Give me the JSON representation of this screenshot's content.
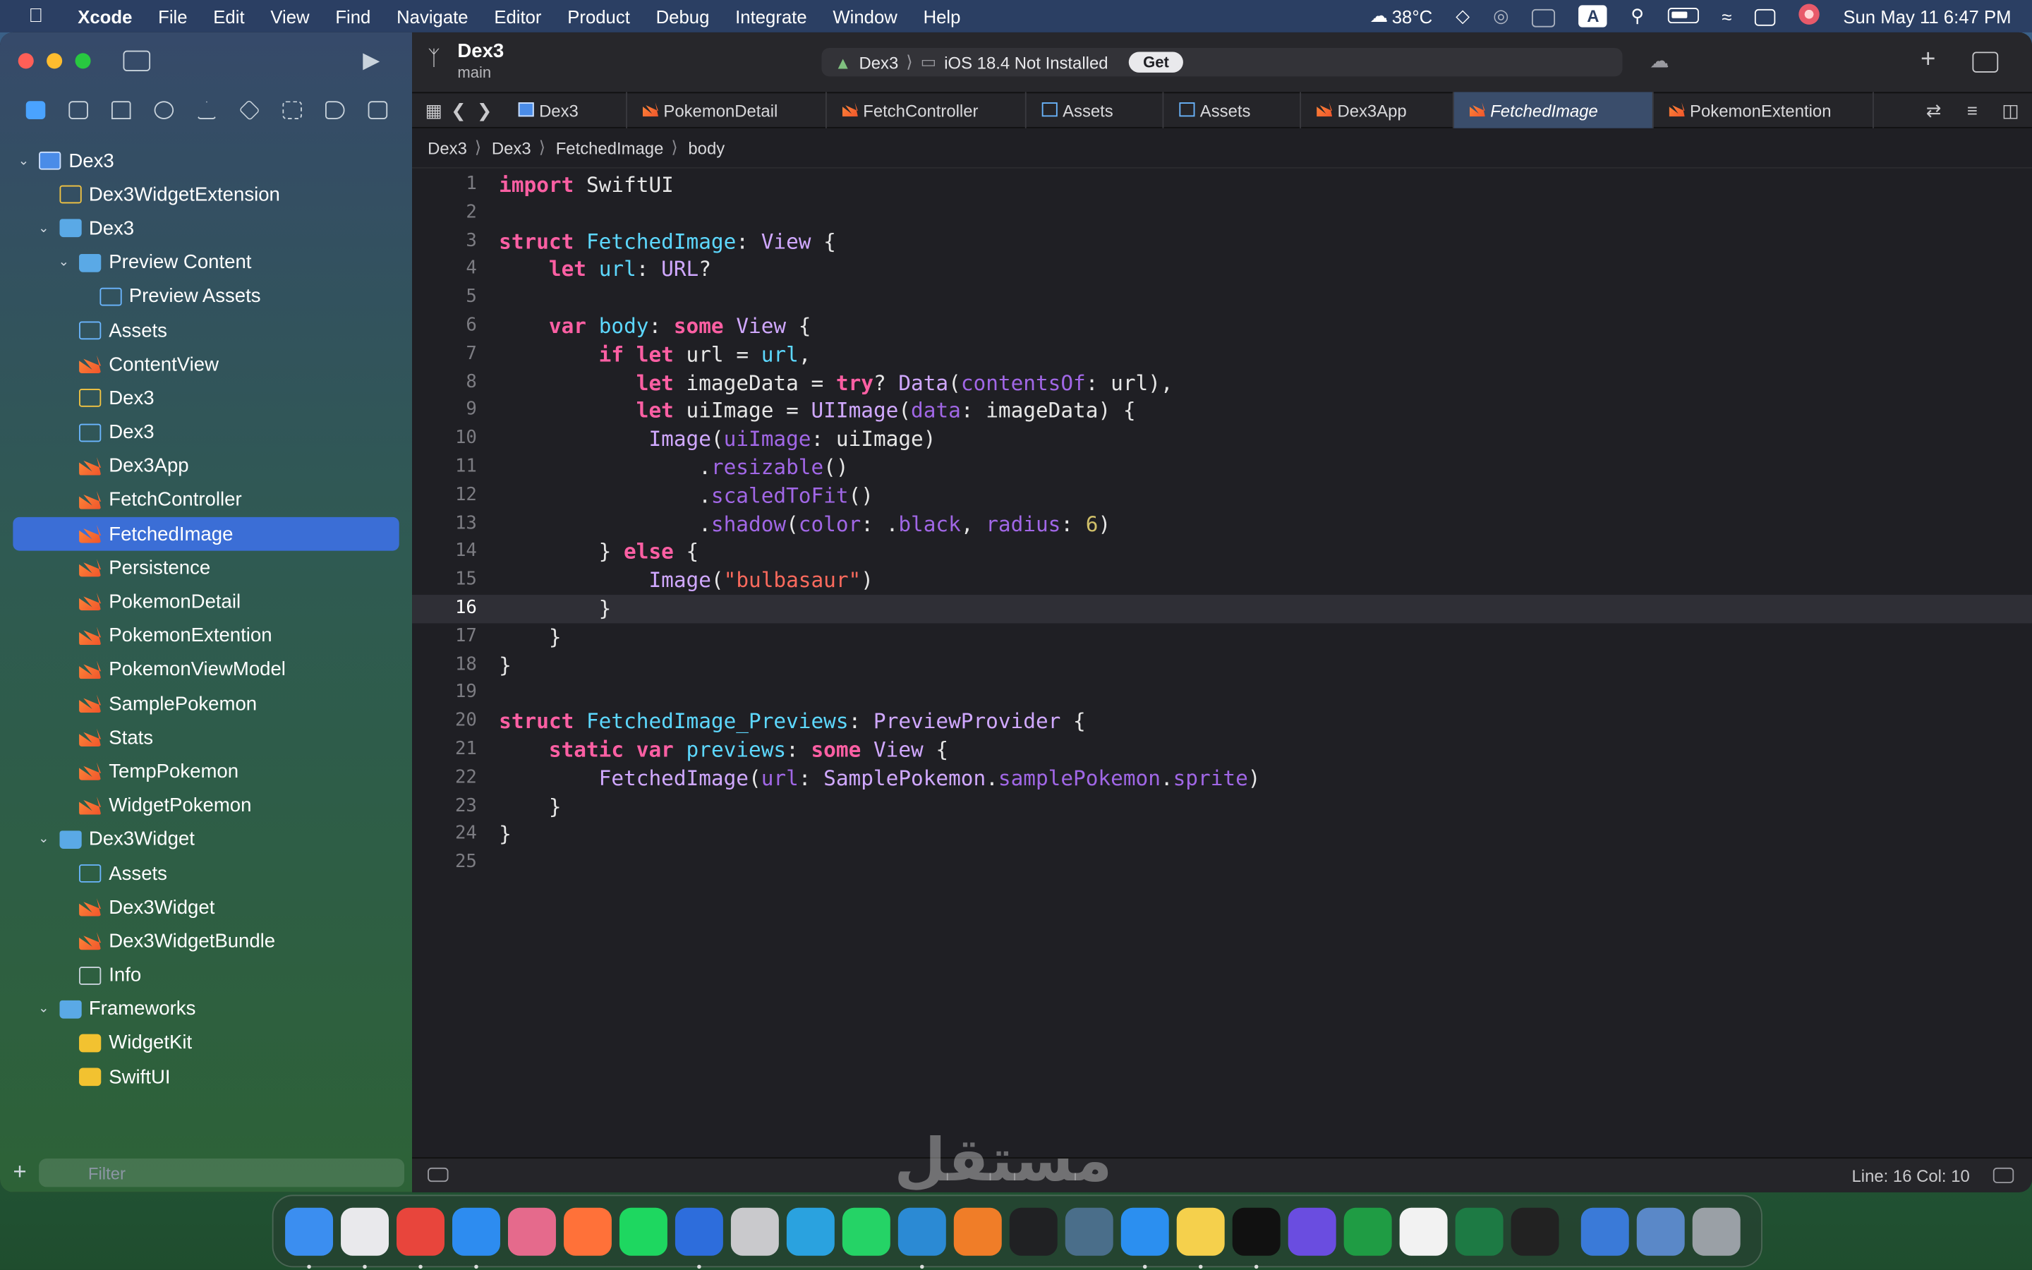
{
  "menubar": {
    "app": "Xcode",
    "items": [
      "File",
      "Edit",
      "View",
      "Find",
      "Navigate",
      "Editor",
      "Product",
      "Debug",
      "Integrate",
      "Window",
      "Help"
    ],
    "weather": "38°C",
    "input_badge": "A",
    "datetime": "Sun May 11  6:47 PM"
  },
  "window": {
    "project": "Dex3",
    "branch": "main",
    "scheme": "Dex3",
    "destination": "iOS 18.4 Not Installed",
    "get_label": "Get"
  },
  "sidebar": {
    "filter_placeholder": "Filter",
    "rows": [
      {
        "label": "Dex3",
        "depth": 0,
        "icon": "project",
        "chev": "down"
      },
      {
        "label": "Dex3WidgetExtension",
        "depth": 1,
        "icon": "ext"
      },
      {
        "label": "Dex3",
        "depth": 1,
        "icon": "folder",
        "chev": "down"
      },
      {
        "label": "Preview Content",
        "depth": 2,
        "icon": "folder",
        "chev": "down"
      },
      {
        "label": "Preview Assets",
        "depth": 3,
        "icon": "asset"
      },
      {
        "label": "Assets",
        "depth": 2,
        "icon": "asset"
      },
      {
        "label": "ContentView",
        "depth": 2,
        "icon": "swift"
      },
      {
        "label": "Dex3",
        "depth": 2,
        "icon": "ext"
      },
      {
        "label": "Dex3",
        "depth": 2,
        "icon": "asset"
      },
      {
        "label": "Dex3App",
        "depth": 2,
        "icon": "swift"
      },
      {
        "label": "FetchController",
        "depth": 2,
        "icon": "swift"
      },
      {
        "label": "FetchedImage",
        "depth": 2,
        "icon": "swift",
        "selected": true
      },
      {
        "label": "Persistence",
        "depth": 2,
        "icon": "swift"
      },
      {
        "label": "PokemonDetail",
        "depth": 2,
        "icon": "swift"
      },
      {
        "label": "PokemonExtention",
        "depth": 2,
        "icon": "swift"
      },
      {
        "label": "PokemonViewModel",
        "depth": 2,
        "icon": "swift"
      },
      {
        "label": "SamplePokemon",
        "depth": 2,
        "icon": "swift"
      },
      {
        "label": "Stats",
        "depth": 2,
        "icon": "swift"
      },
      {
        "label": "TempPokemon",
        "depth": 2,
        "icon": "swift"
      },
      {
        "label": "WidgetPokemon",
        "depth": 2,
        "icon": "swift"
      },
      {
        "label": "Dex3Widget",
        "depth": 1,
        "icon": "folder",
        "chev": "down"
      },
      {
        "label": "Assets",
        "depth": 2,
        "icon": "asset"
      },
      {
        "label": "Dex3Widget",
        "depth": 2,
        "icon": "swift"
      },
      {
        "label": "Dex3WidgetBundle",
        "depth": 2,
        "icon": "swift"
      },
      {
        "label": "Info",
        "depth": 2,
        "icon": "plist"
      },
      {
        "label": "Frameworks",
        "depth": 1,
        "icon": "folder",
        "chev": "down"
      },
      {
        "label": "WidgetKit",
        "depth": 2,
        "icon": "fw"
      },
      {
        "label": "SwiftUI",
        "depth": 2,
        "icon": "fw"
      }
    ]
  },
  "tabs": [
    {
      "label": "Dex3",
      "icon": "project",
      "w": 96
    },
    {
      "label": "PokemonDetail",
      "icon": "swift",
      "w": 154
    },
    {
      "label": "FetchController",
      "icon": "swift",
      "w": 154
    },
    {
      "label": "Assets",
      "icon": "asset",
      "w": 106
    },
    {
      "label": "Assets",
      "icon": "asset",
      "w": 106
    },
    {
      "label": "Dex3App",
      "icon": "swift",
      "w": 118
    },
    {
      "label": "FetchedImage",
      "icon": "swift",
      "w": 154,
      "active": true
    },
    {
      "label": "PokemonExtention",
      "icon": "swift",
      "w": 170
    }
  ],
  "breadcrumb": [
    "Dex3",
    "Dex3",
    "FetchedImage",
    "body"
  ],
  "code": [
    "<span class=\"kw\">import</span> SwiftUI",
    "",
    "<span class=\"kw\">struct</span> <span class=\"dl\">FetchedImage</span>: <span class=\"ty\">View</span> {",
    "    <span class=\"kw\">let</span> <span class=\"dl\">url</span>: <span class=\"ty\">URL</span>?",
    "",
    "    <span class=\"kw\">var</span> <span class=\"dl\">body</span>: <span class=\"kw\">some</span> <span class=\"ty\">View</span> {",
    "        <span class=\"kw\">if</span> <span class=\"kw\">let</span> url = <span class=\"dl\">url</span>,",
    "           <span class=\"kw\">let</span> imageData = <span class=\"kw\">try</span>? <span class=\"ty\">Data</span>(<span class=\"fn\">contentsOf</span>: url),",
    "           <span class=\"kw\">let</span> uiImage = <span class=\"ty\">UIImage</span>(<span class=\"fn\">data</span>: imageData) {",
    "            <span class=\"ty\">Image</span>(<span class=\"fn\">uiImage</span>: uiImage)",
    "                .<span class=\"fn\">resizable</span>()",
    "                .<span class=\"fn\">scaledToFit</span>()",
    "                .<span class=\"fn\">shadow</span>(<span class=\"fn\">color</span>: .<span class=\"fn\">black</span>, <span class=\"fn\">radius</span>: <span class=\"num\">6</span>)",
    "        } <span class=\"kw\">else</span> {",
    "            <span class=\"ty\">Image</span>(<span class=\"st2\">\"bulbasaur\"</span>)",
    "        }",
    "    }",
    "}",
    "",
    "<span class=\"kw\">struct</span> <span class=\"dl\">FetchedImage_Previews</span>: <span class=\"ty\">PreviewProvider</span> {",
    "    <span class=\"kw\">static</span> <span class=\"kw\">var</span> <span class=\"dl\">previews</span>: <span class=\"kw\">some</span> <span class=\"ty\">View</span> {",
    "        <span class=\"ty\">FetchedImage</span>(<span class=\"fn\">url</span>: <span class=\"ty\">SamplePokemon</span>.<span class=\"fn\">samplePokemon</span>.<span class=\"fn\">sprite</span>)",
    "    }",
    "}",
    ""
  ],
  "current_line": 16,
  "status": {
    "position": "Line: 16  Col: 10"
  },
  "dock": [
    {
      "name": "finder-icon",
      "color": "#3b8ef0"
    },
    {
      "name": "launchpad-icon",
      "color": "#e9e9ec"
    },
    {
      "name": "chrome-icon",
      "color": "#e8453c"
    },
    {
      "name": "safari-icon",
      "color": "#2d8cf0"
    },
    {
      "name": "craft-icon",
      "color": "#e56a8c"
    },
    {
      "name": "firefox-icon",
      "color": "#ff7139"
    },
    {
      "name": "spotify-icon",
      "color": "#1ed760"
    },
    {
      "name": "xcode-icon",
      "color": "#2d6ddc"
    },
    {
      "name": "instruments-icon",
      "color": "#c9c9cc"
    },
    {
      "name": "telegram-icon",
      "color": "#2aa2df"
    },
    {
      "name": "whatsapp-icon",
      "color": "#25d366"
    },
    {
      "name": "vscode-icon",
      "color": "#2b8ad4"
    },
    {
      "name": "sublime-icon",
      "color": "#f07d28"
    },
    {
      "name": "chatgpt-icon",
      "color": "#202123"
    },
    {
      "name": "sidekick-icon",
      "color": "#4a6e8a"
    },
    {
      "name": "appstore-icon",
      "color": "#2b8ff0"
    },
    {
      "name": "notes-icon",
      "color": "#f5d04c"
    },
    {
      "name": "terminal-icon",
      "color": "#111111"
    },
    {
      "name": "dash-icon",
      "color": "#6a4de0"
    },
    {
      "name": "recorder-icon",
      "color": "#1f9c44"
    },
    {
      "name": "textedit-icon",
      "color": "#f2f2f2"
    },
    {
      "name": "excel-icon",
      "color": "#1d7a44"
    },
    {
      "name": "mirror-icon",
      "color": "#222222"
    },
    {
      "name": "quicktime-icon",
      "color": "#3a7ad8"
    },
    {
      "name": "preview-icon",
      "color": "#5a88c8"
    },
    {
      "name": "trash-icon",
      "color": "#9aa0a6"
    }
  ]
}
